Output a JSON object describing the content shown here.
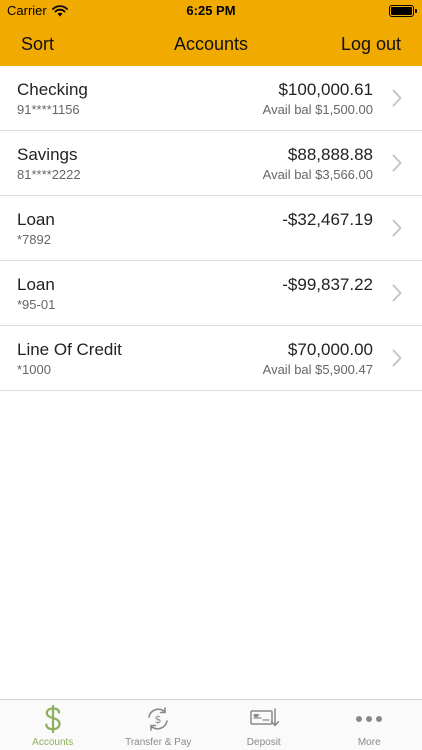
{
  "status": {
    "carrier": "Carrier",
    "time": "6:25 PM"
  },
  "nav": {
    "left": "Sort",
    "title": "Accounts",
    "right": "Log out"
  },
  "accounts": [
    {
      "name": "Checking",
      "number": "91****1156",
      "balance": "$100,000.61",
      "avail": "Avail bal $1,500.00"
    },
    {
      "name": "Savings",
      "number": "81****2222",
      "balance": "$88,888.88",
      "avail": "Avail bal $3,566.00"
    },
    {
      "name": "Loan",
      "number": "*7892",
      "balance": "-$32,467.19",
      "avail": ""
    },
    {
      "name": "Loan",
      "number": "*95-01",
      "balance": "-$99,837.22",
      "avail": ""
    },
    {
      "name": "Line Of Credit",
      "number": "*1000",
      "balance": "$70,000.00",
      "avail": "Avail bal $5,900.47"
    }
  ],
  "tabs": [
    {
      "label": "Accounts",
      "icon": "dollar-icon",
      "active": true
    },
    {
      "label": "Transfer & Pay",
      "icon": "transfer-icon",
      "active": false
    },
    {
      "label": "Deposit",
      "icon": "deposit-icon",
      "active": false
    },
    {
      "label": "More",
      "icon": "more-icon",
      "active": false
    }
  ],
  "colors": {
    "accent": "#F0AA00",
    "active_tab": "#8BB15C",
    "inactive_tab": "#8a8a8a"
  }
}
